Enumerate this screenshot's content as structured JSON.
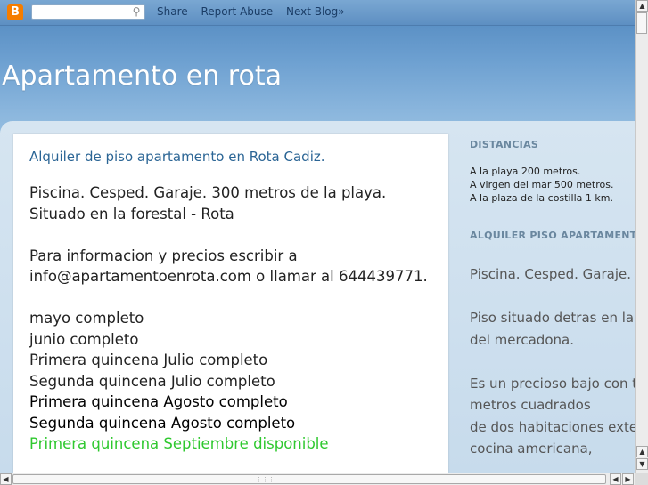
{
  "navbar": {
    "logo_letter": "B",
    "search_icon": "magnifier-icon",
    "search_value": "",
    "links": [
      "Share",
      "Report Abuse",
      "Next Blog»"
    ]
  },
  "blog": {
    "title": "Apartamento en rota"
  },
  "post": {
    "title": "Alquiler de piso apartamento en Rota Cadiz.",
    "lines": [
      "Piscina. Cesped. Garaje. 300 metros de la playa.",
      "Situado en la forestal - Rota",
      "Para informacion y precios escribir a",
      "info@apartamentoenrota.com o llamar al 644439771.",
      "mayo completo",
      "junio completo",
      "Primera quincena Julio completo",
      "Segunda quincena Julio completo",
      "Primera quincena Agosto completo",
      "Segunda quincena Agosto completo",
      "Primera quincena Septiembre disponible"
    ]
  },
  "sidebar": {
    "distancias_title": "DISTANCIAS",
    "distancias": [
      "A la playa 200 metros.",
      "A virgen del mar 500 metros.",
      "A la plaza de la costilla 1 km."
    ],
    "alquiler_title": "ALQUILER PISO APARTAMENTO",
    "body_lines": [
      "Piscina. Cesped. Garaje.",
      "Piso situado detras en la f",
      "del mercadona.",
      "Es un precioso bajo con te",
      "metros cuadrados",
      "de dos habitaciones exter",
      "cocina americana,"
    ]
  },
  "colors": {
    "link_blue": "#2b6595",
    "available_green": "#2ec82e",
    "widget_title": "#6a879f"
  }
}
